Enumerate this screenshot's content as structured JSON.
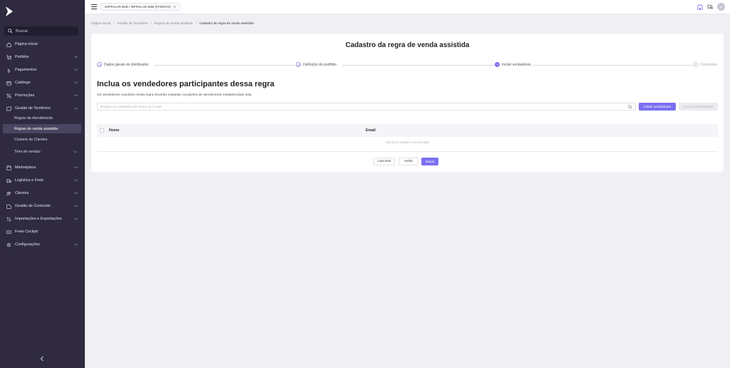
{
  "sidebar": {
    "search_label": "Buscar",
    "items": [
      {
        "label": "Página inicial",
        "icon": "home-icon"
      },
      {
        "label": "Pedidos",
        "icon": "cart-icon"
      },
      {
        "label": "Pagamentos",
        "icon": "dollar-icon"
      },
      {
        "label": "Catálogo",
        "icon": "catalog-icon"
      },
      {
        "label": "Promoções",
        "icon": "percent-icon"
      },
      {
        "label": "Gestão de Territórios",
        "icon": "territory-icon"
      },
      {
        "label": "Marketplace",
        "icon": "marketplace-icon"
      },
      {
        "label": "Logística e Frete",
        "icon": "truck-icon"
      },
      {
        "label": "Clientes",
        "icon": "users-icon"
      },
      {
        "label": "Gestão de Conteúdo",
        "icon": "content-icon"
      },
      {
        "label": "Importações e Exportações",
        "icon": "import-export-icon"
      },
      {
        "label": "Frete Cockpit",
        "icon": "cockpit-icon"
      },
      {
        "label": "Configurações",
        "icon": "gear-icon"
      }
    ],
    "sub_items": [
      {
        "label": "Regras de Atendimento"
      },
      {
        "label": "Regras de venda assistida"
      },
      {
        "label": "Clusters de Clientes"
      },
      {
        "label": "Time de vendas"
      }
    ]
  },
  "topbar": {
    "org_label": "INFRALAR B2B / INFRALAR B2B (PADRÃO)",
    "avatar_initials": "IS"
  },
  "breadcrumb": {
    "items": [
      "Página inicial",
      "Gestão de Territórios",
      "Regras de venda assistida"
    ],
    "current": "Cadastro de regra de venda assistida"
  },
  "card": {
    "title": "Cadastro da regra de venda assistida",
    "steps": [
      {
        "label": "Dados gerais do distribuidor",
        "state": "done"
      },
      {
        "label": "Definição de portfólio",
        "state": "done"
      },
      {
        "label": "Incluir vendedores",
        "state": "current",
        "number": "3"
      },
      {
        "label": "Conclusão",
        "state": "pending",
        "number": "4"
      }
    ],
    "section_title": "Inclua os vendedores participantes dessa regra",
    "section_desc": "Os vendedores incluídos nessa regra deverão respeitar condições de atendimento estabelecidas nela.",
    "search_placeholder": "Busque um vendedor por Nome ou e-mail",
    "insert_button": "Inserir vendedores",
    "remove_button": "Excluir selecionados",
    "table": {
      "columns": [
        "Nome",
        "Email"
      ],
      "empty_text": "Nenhum registro encontrado"
    },
    "cancel_button": "Cancelar",
    "back_button": "Voltar",
    "save_button": "Salvar"
  },
  "colors": {
    "sidebar_bg": "#2f2a40",
    "accent": "#7b6ff0",
    "page_bg": "#f0eff3"
  }
}
